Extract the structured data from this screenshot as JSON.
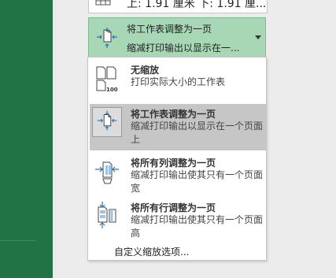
{
  "margins": {
    "value_text": "上: 1.91 厘米 下: 1.91 厘..."
  },
  "scale_dropdown": {
    "title": "将工作表调整为一页",
    "subtitle": "缩减打印输出以显示在一..."
  },
  "menu": {
    "items": [
      {
        "icon": "no-scaling-icon",
        "title": "无缩放",
        "desc": "打印实际大小的工作表",
        "icon_label": "100"
      },
      {
        "icon": "fit-sheet-one-page-icon",
        "title": "将工作表调整为一页",
        "desc": "缩减打印输出以显示在一个页面上"
      },
      {
        "icon": "fit-columns-one-page-icon",
        "title": "将所有列调整为一页",
        "desc": "缩减打印输出使其只有一个页面宽"
      },
      {
        "icon": "fit-rows-one-page-icon",
        "title": "将所有行调整为一页",
        "desc": "缩减打印输出使其只有一个页面高"
      }
    ],
    "custom": "自定义缩放选项..."
  },
  "colors": {
    "accent_green": "#217346",
    "selected_dropdown": "#a8d7b6",
    "selected_item": "#c6c6c6",
    "arrow_blue": "#2e75b6"
  }
}
